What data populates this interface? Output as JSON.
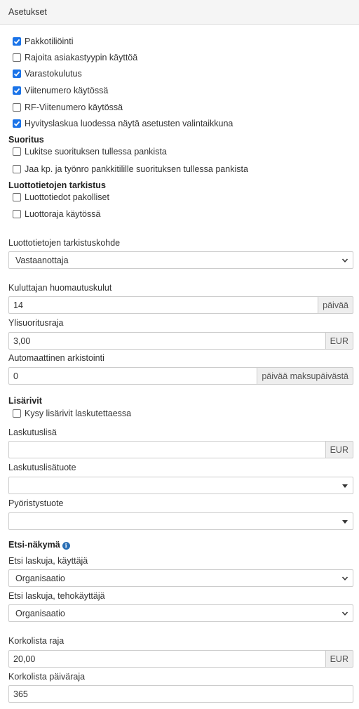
{
  "panel": {
    "title": "Asetukset"
  },
  "checkboxes_main": [
    {
      "label": "Pakkotiliöinti",
      "checked": true
    },
    {
      "label": "Rajoita asiakastyypin käyttöä",
      "checked": false
    },
    {
      "label": "Varastokulutus",
      "checked": true
    },
    {
      "label": "Viitenumero käytössä",
      "checked": true
    },
    {
      "label": "RF-Viitenumero käytössä",
      "checked": false
    },
    {
      "label": "Hyvityslaskua luodessa näytä asetusten valintaikkuna",
      "checked": true
    }
  ],
  "suoritus": {
    "title": "Suoritus",
    "items": [
      {
        "label": "Lukitse suorituksen tullessa pankista",
        "checked": false
      },
      {
        "label": "Jaa kp. ja työnro pankkitilille suorituksen tullessa pankista",
        "checked": false
      }
    ]
  },
  "luottotiedot": {
    "title": "Luottotietojen tarkistus",
    "items": [
      {
        "label": "Luottotiedot pakolliset",
        "checked": false
      },
      {
        "label": "Luottoraja käytössä",
        "checked": false
      }
    ]
  },
  "tarkistuskohde": {
    "label": "Luottotietojen tarkistuskohde",
    "value": "Vastaanottaja"
  },
  "huomautuskulut": {
    "label": "Kuluttajan huomautuskulut",
    "value": "14",
    "addon": "päivää"
  },
  "ylisuoritusraja": {
    "label": "Ylisuoritusraja",
    "value": "3,00",
    "addon": "EUR"
  },
  "arkistointi": {
    "label": "Automaattinen arkistointi",
    "value": "0",
    "addon": "päivää maksupäivästä"
  },
  "lisarivit": {
    "title": "Lisärivit",
    "items": [
      {
        "label": "Kysy lisärivit laskutettaessa",
        "checked": false
      }
    ]
  },
  "laskutuslisa": {
    "label": "Laskutuslisä",
    "value": "",
    "addon": "EUR"
  },
  "laskutuslisatuote": {
    "label": "Laskutuslisätuote",
    "value": ""
  },
  "pyoristystuote": {
    "label": "Pyöristystuote",
    "value": ""
  },
  "etsi": {
    "title": "Etsi-näkymä",
    "info_icon": "info-icon",
    "kayttaja": {
      "label": "Etsi laskuja, käyttäjä",
      "value": "Organisaatio"
    },
    "tehokayttaja": {
      "label": "Etsi laskuja, tehokäyttäjä",
      "value": "Organisaatio"
    }
  },
  "korkolista_raja": {
    "label": "Korkolista raja",
    "value": "20,00",
    "addon": "EUR"
  },
  "korkolista_paivaraja": {
    "label": "Korkolista päiväraja",
    "value": "365"
  },
  "colors": {
    "accent": "#1a73e8",
    "info": "#2a6fb5"
  }
}
